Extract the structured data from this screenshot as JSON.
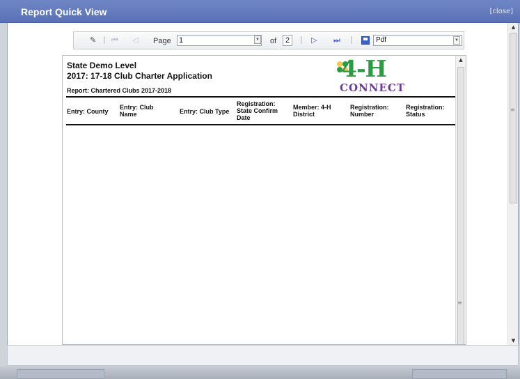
{
  "dialog": {
    "title": "Report Quick View",
    "close_label": "[close]"
  },
  "toolbar": {
    "page_label": "Page",
    "page_value": "1",
    "of_label": "of",
    "total_pages": "2",
    "export_format": "Pdf",
    "icons": [
      "edit-icon",
      "first-page-icon",
      "prev-page-icon",
      "next-page-icon",
      "last-page-icon",
      "save-icon"
    ]
  },
  "report": {
    "org_name": "State Demo Level",
    "form_title": "2017: 17-18 Club Charter Application",
    "report_name": "Report: Chartered Clubs 2017-2018",
    "logo": {
      "main": "4-H",
      "sub": "CONNECT"
    },
    "columns": [
      [
        "Entry: County"
      ],
      [
        "Entry: Club",
        "Name"
      ],
      [
        "Entry: Club Type"
      ],
      [
        "Registration:",
        "State Confirm",
        "Date"
      ],
      [
        "Member: 4-H",
        "District"
      ],
      [
        "Registration:",
        "Number"
      ],
      [
        "Registration:",
        "Status"
      ]
    ]
  },
  "colors": {
    "titlebar": "#5a71b5",
    "logo_green": "#2f9a45",
    "logo_purple": "#6a3d8d"
  }
}
